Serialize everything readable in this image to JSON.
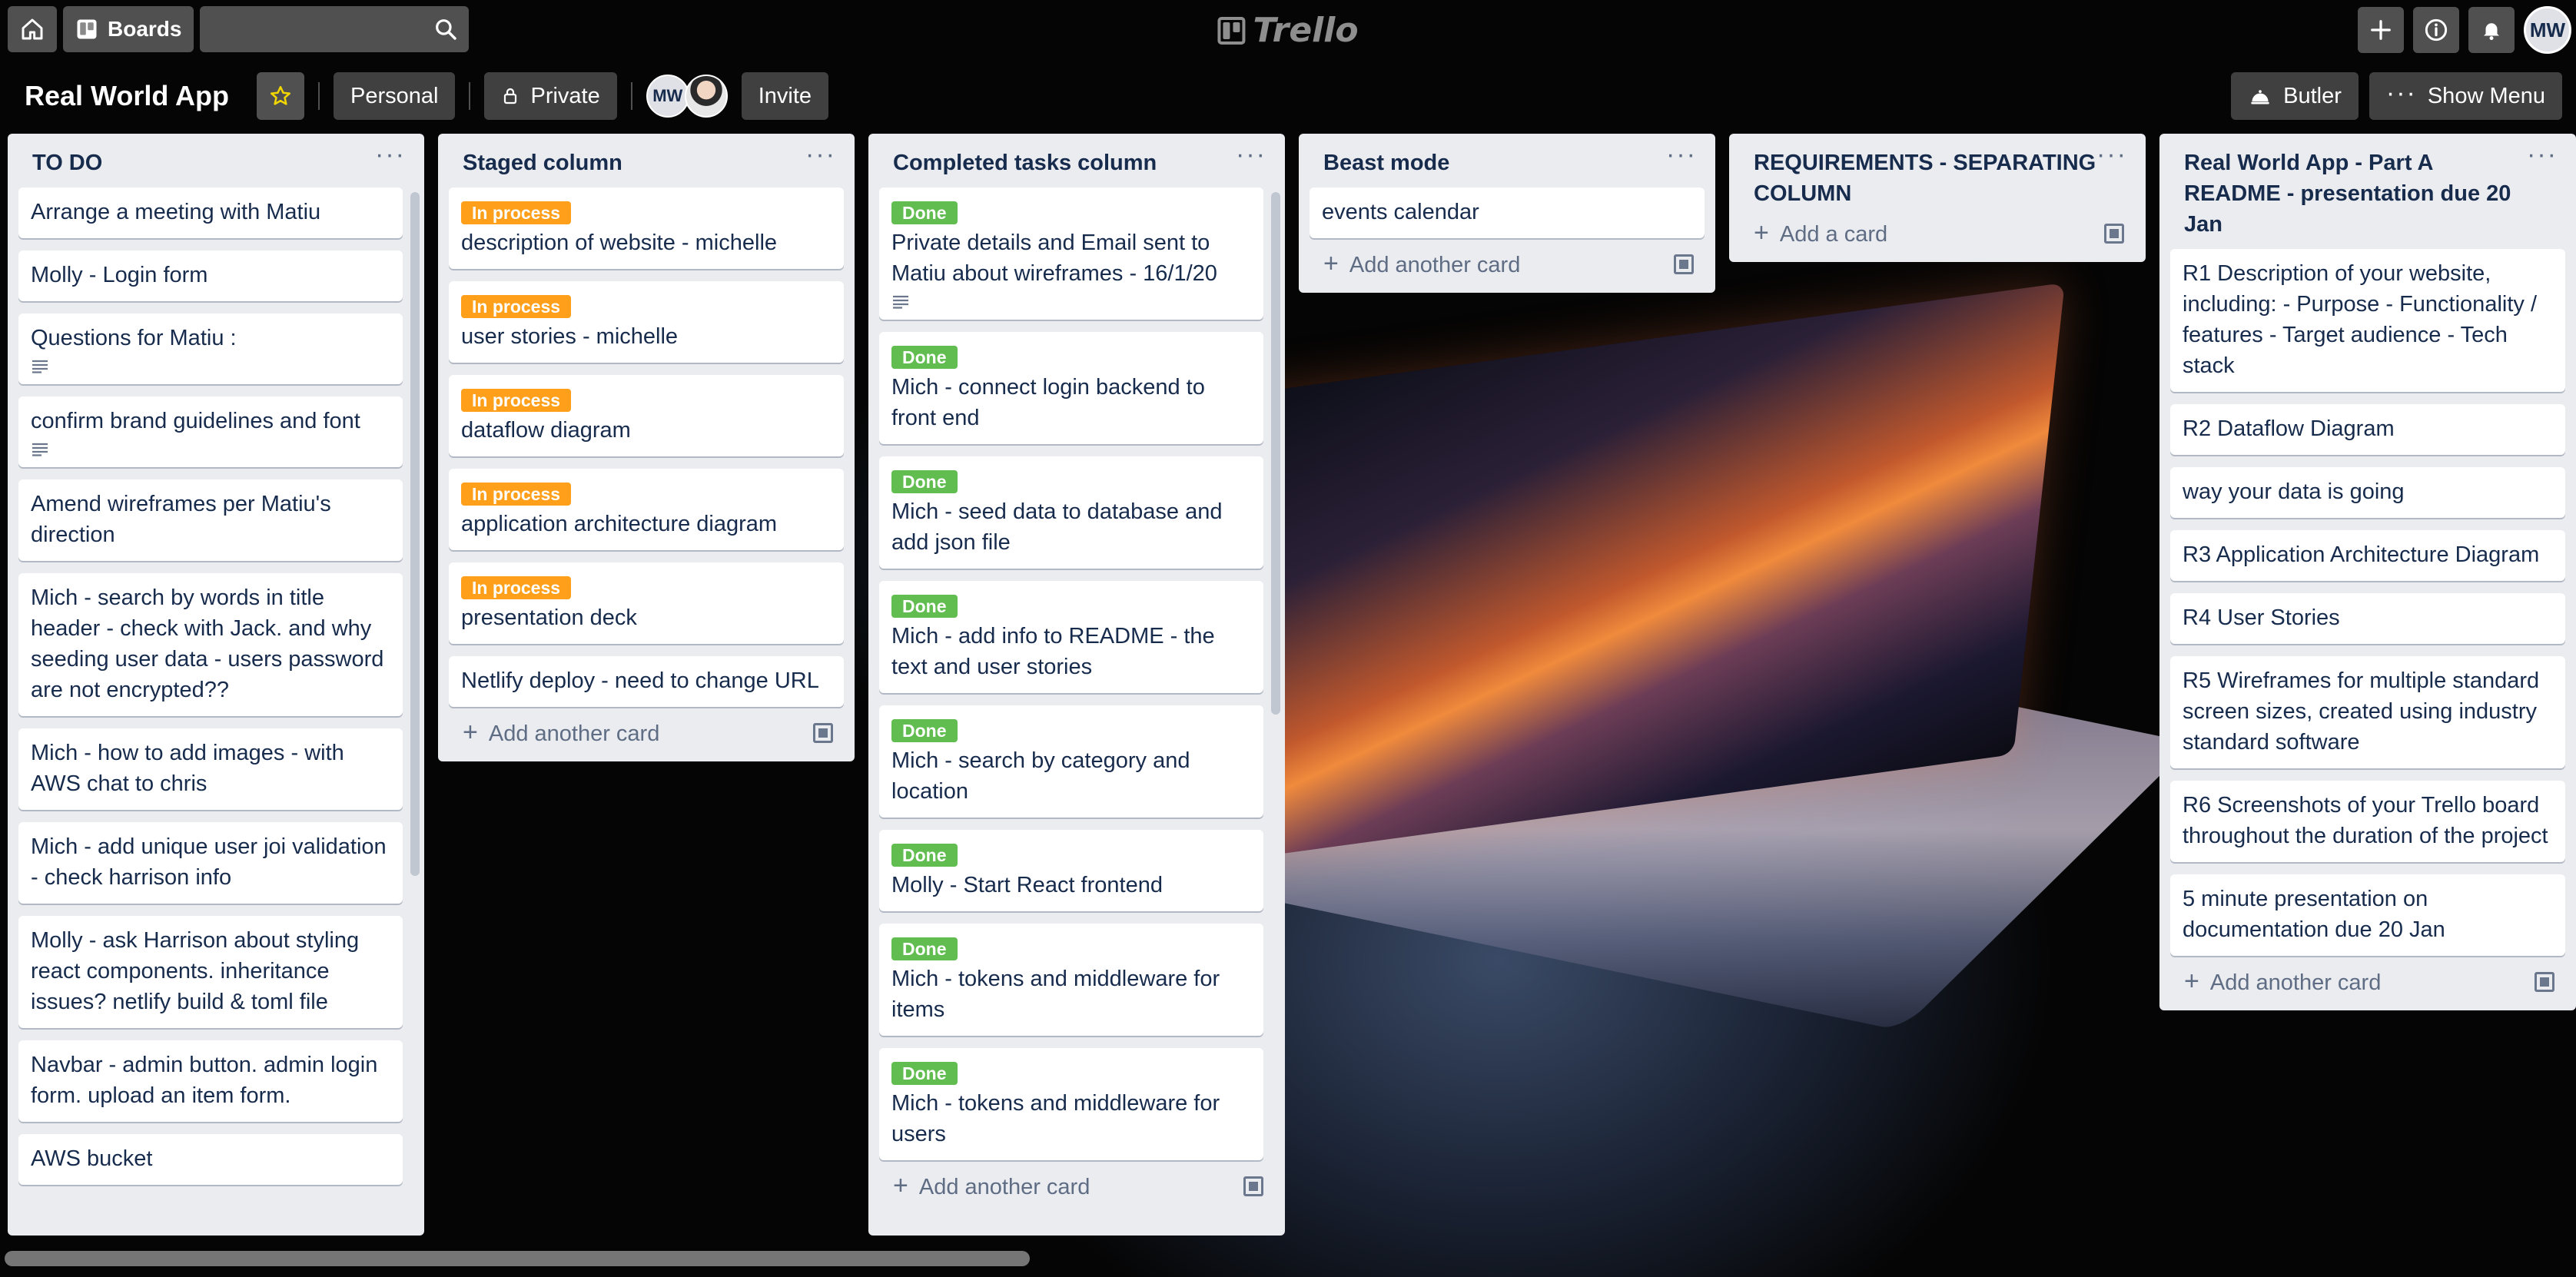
{
  "header": {
    "boards_label": "Boards",
    "search_placeholder": "",
    "logo_text": "Trello",
    "user_initials": "MW"
  },
  "board": {
    "title": "Real World App",
    "personal_label": "Personal",
    "private_label": "Private",
    "member_initials": "MW",
    "invite_label": "Invite",
    "butler_label": "Butler",
    "show_menu_label": "Show Menu"
  },
  "lists": [
    {
      "title": "TO DO",
      "cards": [
        {
          "text": "Arrange a meeting with Matiu"
        },
        {
          "text": "Molly - Login form"
        },
        {
          "text": "Questions for Matiu :",
          "has_description": true
        },
        {
          "text": "confirm brand guidelines and font",
          "has_description": true
        },
        {
          "text": "Amend wireframes per Matiu's direction"
        },
        {
          "text": "Mich - search by words in title header - check with Jack. and why seeding user data - users password are not encrypted??"
        },
        {
          "text": "Mich - how to add images - with AWS chat to chris"
        },
        {
          "text": "Mich - add unique user joi validation - check harrison info"
        },
        {
          "text": "Molly - ask Harrison about styling react components. inheritance issues? netlify build & toml file"
        },
        {
          "text": "Navbar - admin button. admin login form. upload an item form."
        },
        {
          "text": "AWS bucket"
        }
      ]
    },
    {
      "title": "Staged column",
      "add_label": "Add another card",
      "cards": [
        {
          "label": "In process",
          "label_color": "orange",
          "text": "description of website - michelle"
        },
        {
          "label": "In process",
          "label_color": "orange",
          "text": "user stories - michelle"
        },
        {
          "label": "In process",
          "label_color": "orange",
          "text": "dataflow diagram"
        },
        {
          "label": "In process",
          "label_color": "orange",
          "text": "application architecture diagram"
        },
        {
          "label": "In process",
          "label_color": "orange",
          "text": "presentation deck"
        },
        {
          "text": "Netlify deploy - need to change URL"
        }
      ]
    },
    {
      "title": "Completed tasks column",
      "add_label": "Add another card",
      "cards": [
        {
          "label": "Done",
          "label_color": "green",
          "text": "Private details and Email sent to Matiu about wireframes - 16/1/20",
          "has_description": true
        },
        {
          "label": "Done",
          "label_color": "green",
          "text": "Mich - connect login backend to front end"
        },
        {
          "label": "Done",
          "label_color": "green",
          "text": "Mich - seed data to database and add json file"
        },
        {
          "label": "Done",
          "label_color": "green",
          "text": "Mich - add info to README - the text and user stories"
        },
        {
          "label": "Done",
          "label_color": "green",
          "text": "Mich - search by category and location"
        },
        {
          "label": "Done",
          "label_color": "green",
          "text": "Molly - Start React frontend"
        },
        {
          "label": "Done",
          "label_color": "green",
          "text": "Mich - tokens and middleware for items"
        },
        {
          "label": "Done",
          "label_color": "green",
          "text": "Mich - tokens and middleware for users"
        }
      ]
    },
    {
      "title": "Beast mode",
      "add_label": "Add another card",
      "cards": [
        {
          "text": "events calendar"
        }
      ]
    },
    {
      "title": "REQUIREMENTS - SEPARATING COLUMN",
      "add_label": "Add a card",
      "cards": []
    },
    {
      "title": "Real World App - Part A README - presentation due 20 Jan",
      "add_label": "Add another card",
      "cards": [
        {
          "text": "R1 Description of your website, including: - Purpose - Functionality / features - Target audience - Tech stack"
        },
        {
          "text": "R2 Dataflow Diagram"
        },
        {
          "text": "way your data is going"
        },
        {
          "text": "R3 Application Architecture Diagram"
        },
        {
          "text": "R4 User Stories"
        },
        {
          "text": "R5 Wireframes for multiple standard screen sizes, created using industry standard software"
        },
        {
          "text": "R6 Screenshots of your Trello board throughout the duration of the project"
        },
        {
          "text": "5 minute presentation on documentation due 20 Jan"
        }
      ]
    }
  ]
}
